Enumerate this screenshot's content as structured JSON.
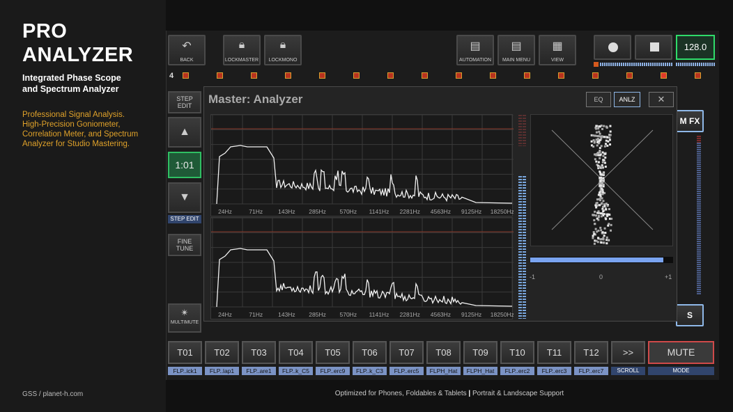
{
  "promo": {
    "title_line1": "PRO",
    "title_line2": "ANALYZER",
    "subtitle_line1": "Integrated Phase Scope",
    "subtitle_line2": "and Spectrum Analyzer",
    "desc_line1": "Professional Signal Analysis.",
    "desc_line2": "High-Precision Goniometer,",
    "desc_line3": "Correlation Meter, and Spectrum",
    "desc_line4": "Analyzer for Studio Mastering.",
    "footer": "GSS / planet-h.com"
  },
  "bottom_footer_part1": "Optimized for Phones, Foldables & Tablets",
  "bottom_footer_sep": "|",
  "bottom_footer_part2": "Portrait & Landscape Support",
  "toolbar": {
    "back": "BACK",
    "lockmaster": "LOCKMASTER",
    "lockmono": "LOCKMONO",
    "automation": "AUTOMATION",
    "main_menu": "MAIN MENU",
    "view": "VIEW",
    "tempo": "128.0"
  },
  "track_number": "4",
  "side": {
    "step_edit_line1": "STEP",
    "step_edit_line2": "EDIT",
    "position": "1:01",
    "step_edit_tag": "STEP EDIT",
    "fine_tune_line1": "FINE",
    "fine_tune_line2": "TUNE",
    "multimute": "MULTIMUTE"
  },
  "background_labels": {
    "fx": "M FX",
    "s": "S"
  },
  "analyzer": {
    "title": "Master: Analyzer",
    "eq_label": "EQ",
    "anlz_label": "ANLZ",
    "close_label": "✕",
    "freq_ticks": [
      "24Hz",
      "71Hz",
      "143Hz",
      "285Hz",
      "570Hz",
      "1141Hz",
      "2281Hz",
      "4563Hz",
      "9125Hz",
      "18250Hz"
    ],
    "corr_labels": [
      "-1",
      "0",
      "+1"
    ],
    "correlation_fill": 0.93
  },
  "tracks": [
    {
      "label": "T01",
      "sample": "FLP..ick1"
    },
    {
      "label": "T02",
      "sample": "FLP..lap1"
    },
    {
      "label": "T03",
      "sample": "FLP..are1"
    },
    {
      "label": "T04",
      "sample": "FLP..k_C5"
    },
    {
      "label": "T05",
      "sample": "FLP..erc9"
    },
    {
      "label": "T06",
      "sample": "FLP..k_C3"
    },
    {
      "label": "T07",
      "sample": "FLP..erc5"
    },
    {
      "label": "T08",
      "sample": "FLPH_Hat"
    },
    {
      "label": "T09",
      "sample": "FLPH_Hat"
    },
    {
      "label": "T10",
      "sample": "FLP..erc2"
    },
    {
      "label": "T11",
      "sample": "FLP..erc3"
    },
    {
      "label": "T12",
      "sample": "FLP..erc7"
    }
  ],
  "scroll_btn": ">>",
  "scroll_tag": "SCROLL",
  "mute_label": "MUTE",
  "mode_tag": "MODE",
  "colors": {
    "tempo_border": "#2fdc6a",
    "tag_blue": "#7b93c5",
    "mute_border": "#d04a4a",
    "corr_fill": "#7aa4f0",
    "promo_accent": "#e0a22a"
  }
}
